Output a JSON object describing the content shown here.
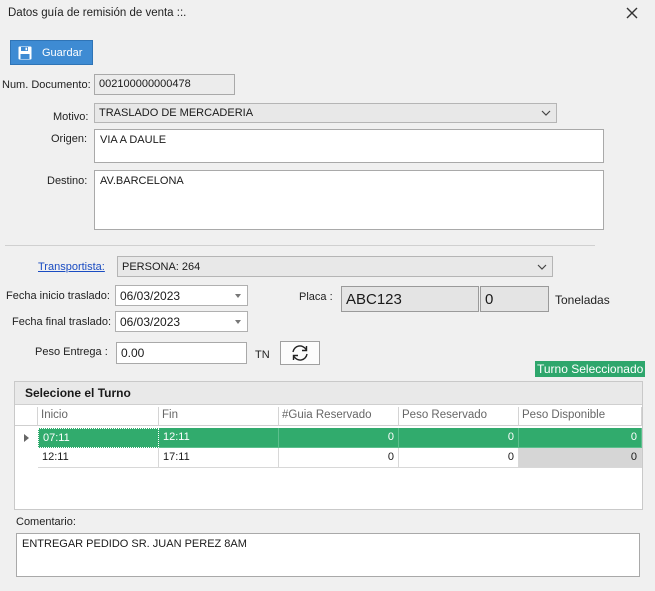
{
  "window": {
    "title": "Datos guía de remisión de venta ::."
  },
  "toolbar": {
    "save_label": "Guardar"
  },
  "form": {
    "num_doc_label": "Num. Documento:",
    "num_doc_value": "002100000000478",
    "motivo_label": "Motivo:",
    "motivo_value": "TRASLADO DE MERCADERIA",
    "origen_label": "Origen:",
    "origen_value": "VIA A DAULE",
    "destino_label": "Destino:",
    "destino_value": "AV.BARCELONA",
    "transportista_label": "Transportista:",
    "transportista_value": "PERSONA: 264",
    "fecha_inicio_label": "Fecha inicio traslado:",
    "fecha_inicio_value": "06/03/2023",
    "fecha_final_label": "Fecha final traslado:",
    "fecha_final_value": "06/03/2023",
    "placa_label": "Placa :",
    "placa_value": "ABC123",
    "toneladas_value": "0",
    "toneladas_label": "Toneladas",
    "peso_label": "Peso Entrega :",
    "peso_value": "0.00",
    "peso_unit": "TN",
    "turno_badge": "Turno Seleccionado"
  },
  "grid": {
    "title": "Selecione el Turno",
    "columns": [
      "Inicio",
      "Fin",
      "#Guia Reservado",
      "Peso Reservado",
      "Peso Disponible"
    ],
    "rows": [
      {
        "inicio": "07:11",
        "fin": "12:11",
        "guia": "0",
        "peso_res": "0",
        "peso_disp": "0"
      },
      {
        "inicio": "12:11",
        "fin": "17:11",
        "guia": "0",
        "peso_res": "0",
        "peso_disp": "0"
      }
    ]
  },
  "comentario": {
    "label": "Comentario:",
    "value": "ENTREGAR PEDIDO SR. JUAN PEREZ 8AM"
  }
}
